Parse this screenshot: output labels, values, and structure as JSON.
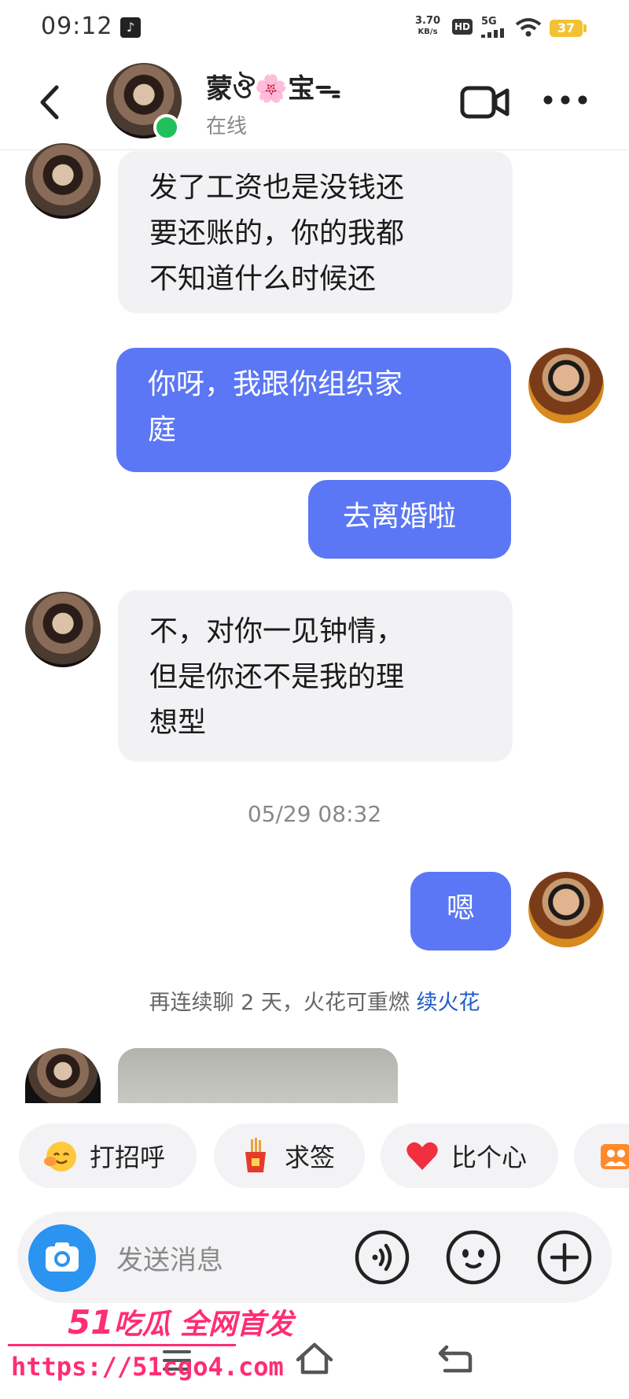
{
  "status_bar": {
    "time": "09:12",
    "net_speed_value": "3.70",
    "net_speed_unit": "KB/s",
    "hd": "HD",
    "network": "5G",
    "battery": "37"
  },
  "header": {
    "contact_name": "蒙ঔ🌸宝ᯓ",
    "status": "在线"
  },
  "messages": [
    {
      "side": "left",
      "lines": [
        "发了工资也是没钱还",
        "要还账的，你的我都",
        "不知道什么时候还"
      ]
    },
    {
      "side": "right",
      "lines": [
        "你呀，我跟你组织家",
        "庭"
      ]
    },
    {
      "side": "right",
      "lines": [
        "去离婚啦"
      ]
    },
    {
      "side": "left",
      "lines": [
        "不，对你一见钟情，",
        "但是你还不是我的理",
        "想型"
      ]
    },
    {
      "side": "right",
      "lines": [
        "嗯"
      ]
    }
  ],
  "timestamp": "05/29 08:32",
  "notice": {
    "text": "再连续聊 2 天，火花可重燃 ",
    "link": "续火花"
  },
  "quick_replies": [
    {
      "label": "打招呼",
      "icon": "wave-emoji-icon"
    },
    {
      "label": "求签",
      "icon": "fortune-sticks-icon"
    },
    {
      "label": "比个心",
      "icon": "heart-icon"
    }
  ],
  "input": {
    "placeholder": "发送消息"
  },
  "watermark": {
    "brand_num": "51",
    "brand_text": "吃瓜 全网首发",
    "url": "https://51cgo4.com"
  },
  "colors": {
    "outgoing_bubble": "#5b77f5",
    "incoming_bubble": "#f2f2f4",
    "online": "#22c05a",
    "link": "#1f5bc9",
    "camera_button": "#2b93f0",
    "watermark": "#ff2d73"
  }
}
